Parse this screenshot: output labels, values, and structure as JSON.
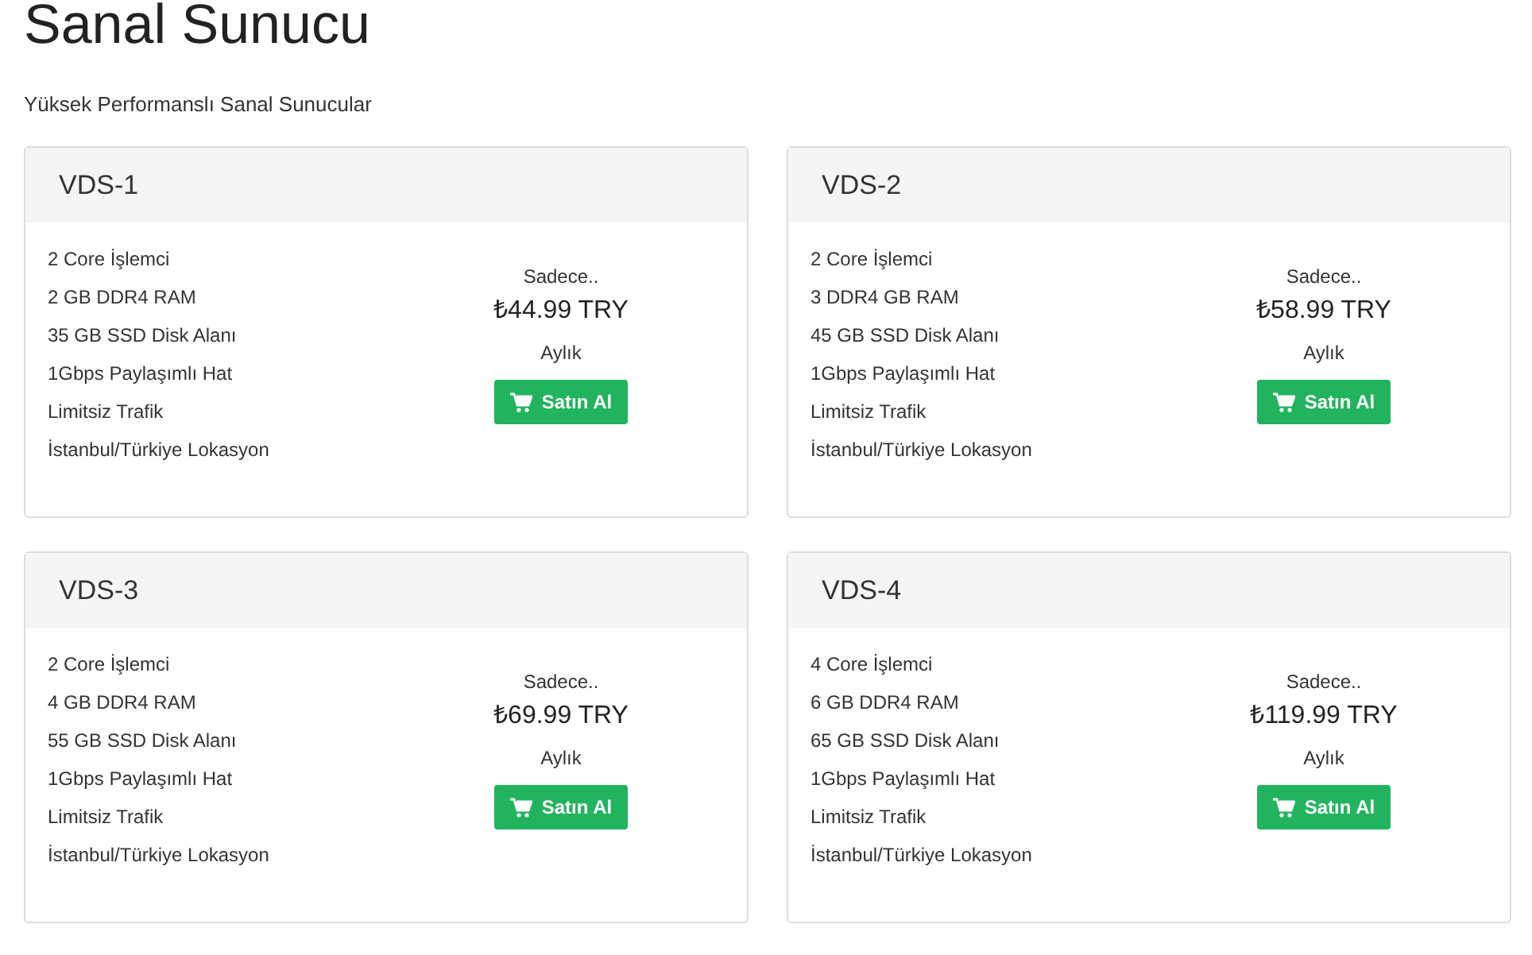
{
  "title": "Sanal Sunucu",
  "subtitle": "Yüksek Performanslı Sanal Sunucular",
  "plans": [
    {
      "name": "VDS-1",
      "features": [
        "2 Core İşlemci",
        "2 GB DDR4 RAM",
        "35 GB SSD Disk Alanı",
        "1Gbps Paylaşımlı Hat",
        "Limitsiz Trafik",
        "İstanbul/Türkiye Lokasyon"
      ],
      "price_note": "Sadece..",
      "price": "₺44.99 TRY",
      "period": "Aylık",
      "button": "Satın Al"
    },
    {
      "name": "VDS-2",
      "features": [
        "2 Core İşlemci",
        "3 DDR4 GB RAM",
        "45 GB SSD Disk Alanı",
        "1Gbps Paylaşımlı Hat",
        "Limitsiz Trafik",
        "İstanbul/Türkiye Lokasyon"
      ],
      "price_note": "Sadece..",
      "price": "₺58.99 TRY",
      "period": "Aylık",
      "button": "Satın Al"
    },
    {
      "name": "VDS-3",
      "features": [
        "2 Core İşlemci",
        "4 GB DDR4 RAM",
        "55 GB SSD Disk Alanı",
        "1Gbps Paylaşımlı Hat",
        "Limitsiz Trafik",
        "İstanbul/Türkiye Lokasyon"
      ],
      "price_note": "Sadece..",
      "price": "₺69.99 TRY",
      "period": "Aylık",
      "button": "Satın Al"
    },
    {
      "name": "VDS-4",
      "features": [
        "4 Core İşlemci",
        "6 GB DDR4 RAM",
        "65 GB SSD Disk Alanı",
        "1Gbps Paylaşımlı Hat",
        "Limitsiz Trafik",
        "İstanbul/Türkiye Lokasyon"
      ],
      "price_note": "Sadece..",
      "price": "₺119.99 TRY",
      "period": "Aylık",
      "button": "Satın Al"
    }
  ]
}
